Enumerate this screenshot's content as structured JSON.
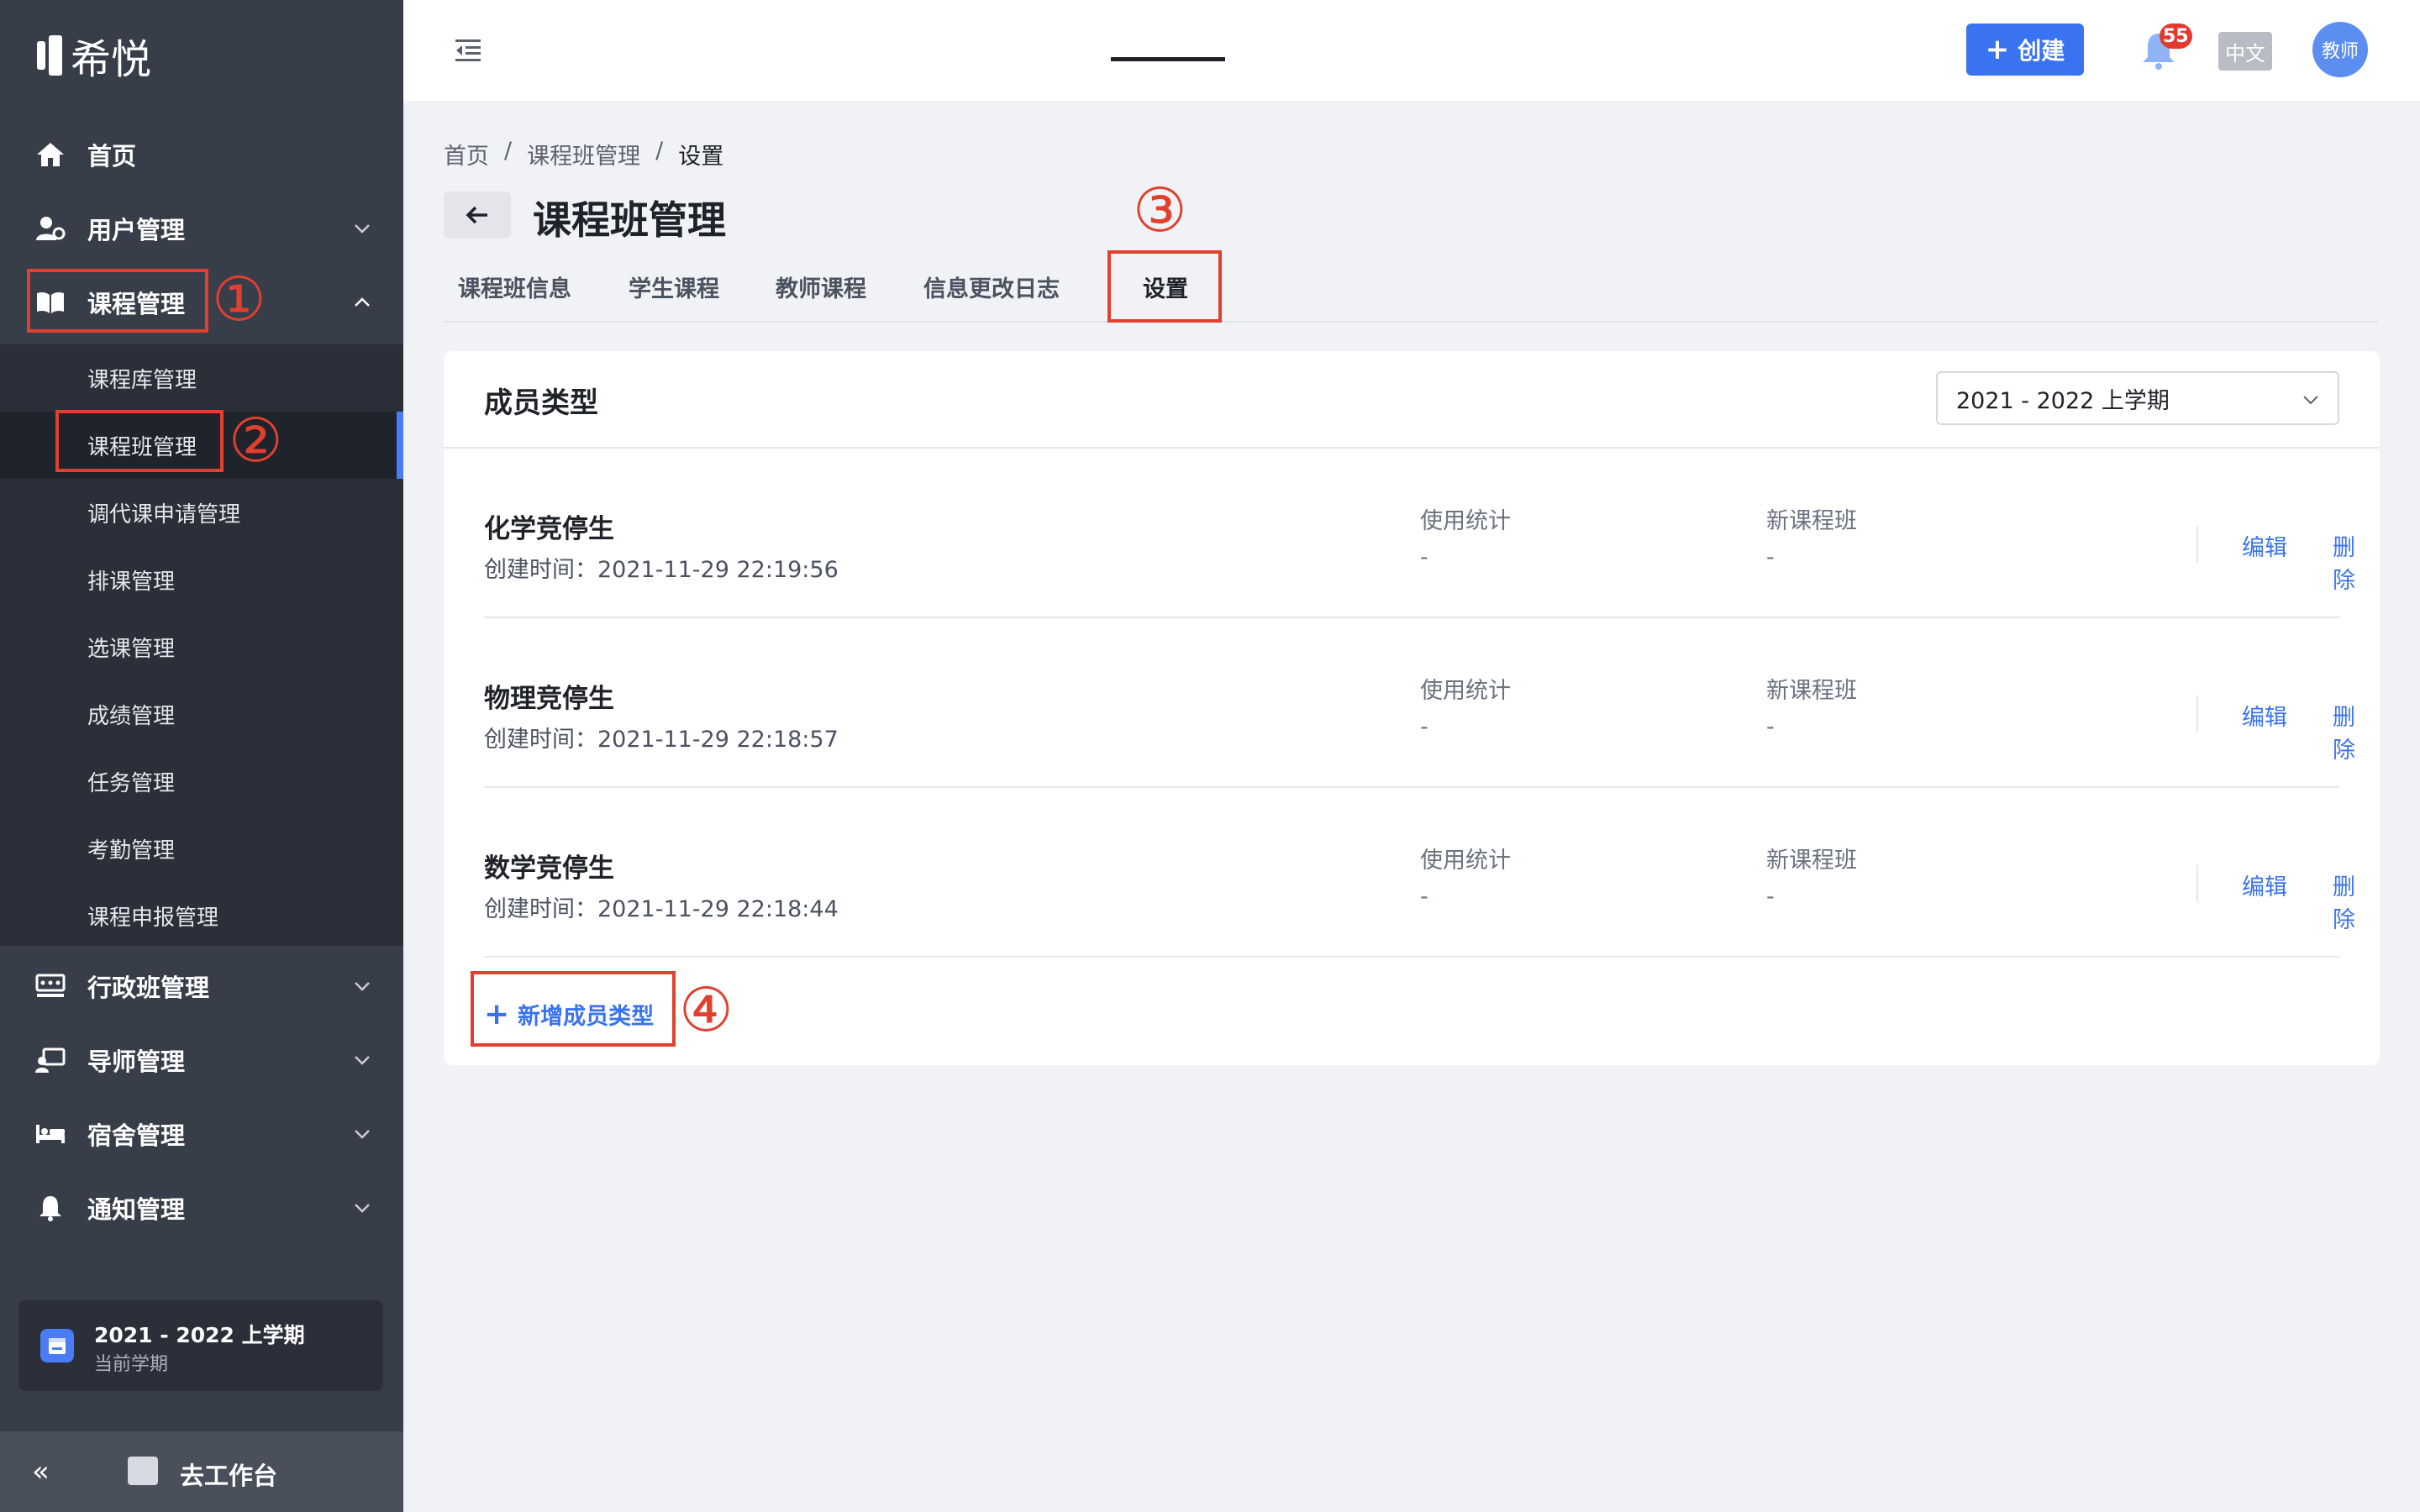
{
  "app": {
    "logo_text": "希悦"
  },
  "sidebar": {
    "items": [
      {
        "label": "首页",
        "icon": "home-icon"
      },
      {
        "label": "用户管理",
        "icon": "user-gear-icon"
      },
      {
        "label": "课程管理",
        "icon": "book-icon"
      },
      {
        "label": "行政班管理",
        "icon": "class-board-icon"
      },
      {
        "label": "导师管理",
        "icon": "mentor-icon"
      },
      {
        "label": "宿舍管理",
        "icon": "bed-icon"
      },
      {
        "label": "通知管理",
        "icon": "bell-icon"
      }
    ],
    "submenu": [
      "课程库管理",
      "课程班管理",
      "调代课申请管理",
      "排课管理",
      "选课管理",
      "成绩管理",
      "任务管理",
      "考勤管理",
      "课程申报管理"
    ],
    "term": {
      "title": "2021 - 2022 上学期",
      "subtitle": "当前学期"
    },
    "workbench": {
      "collapse_glyph": "«",
      "label": "去工作台"
    }
  },
  "topbar": {
    "create_label": "创建",
    "notification_count": "55",
    "lang_label": "中文",
    "avatar_label": "教师"
  },
  "breadcrumb": [
    "首页",
    "课程班管理",
    "设置"
  ],
  "breadcrumb_sep": "/",
  "page_title": "课程班管理",
  "tabs": [
    "课程班信息",
    "学生课程",
    "教师课程",
    "信息更改日志",
    "设置"
  ],
  "card": {
    "title": "成员类型",
    "term_select": "2021 - 2022 上学期",
    "rows": [
      {
        "name": "化学竞停生",
        "created": "创建时间：2021-11-29 22:19:56",
        "h1": "使用统计",
        "v1": "-",
        "h2": "新课程班",
        "v2": "-",
        "edit": "编辑",
        "delete": "删除"
      },
      {
        "name": "物理竞停生",
        "created": "创建时间：2021-11-29 22:18:57",
        "h1": "使用统计",
        "v1": "-",
        "h2": "新课程班",
        "v2": "-",
        "edit": "编辑",
        "delete": "删除"
      },
      {
        "name": "数学竞停生",
        "created": "创建时间：2021-11-29 22:18:44",
        "h1": "使用统计",
        "v1": "-",
        "h2": "新课程班",
        "v2": "-",
        "edit": "编辑",
        "delete": "删除"
      }
    ],
    "add_label": "新增成员类型"
  },
  "annotations": [
    "①",
    "②",
    "③",
    "④"
  ],
  "colors": {
    "sidebar": "#383d4a",
    "accent": "#3a73f0",
    "annotation": "#e0402e",
    "badge": "#e23a2e"
  }
}
